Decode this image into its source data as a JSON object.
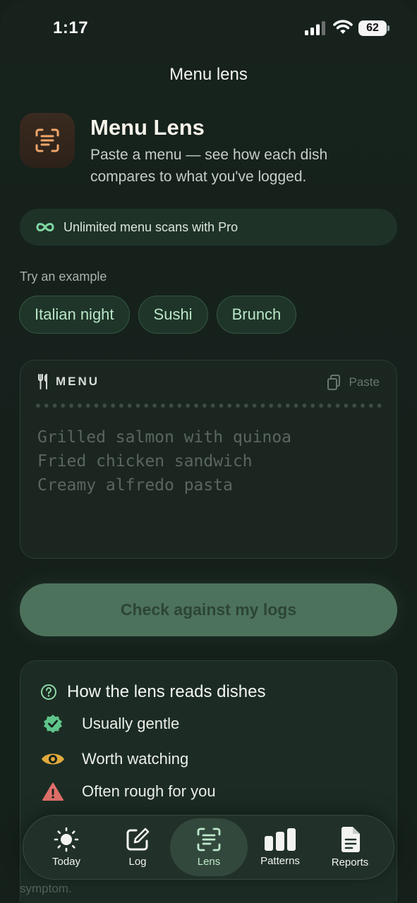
{
  "status_bar": {
    "time": "1:17",
    "battery": "62"
  },
  "nav": {
    "title": "Menu lens"
  },
  "header": {
    "icon": "document-scan-icon",
    "title": "Menu Lens",
    "subtitle": "Paste a menu — see how each dish compares to what you've logged."
  },
  "pro_banner": {
    "icon": "infinity-icon",
    "text": "Unlimited menu scans with Pro"
  },
  "examples": {
    "label": "Try an example",
    "chips": [
      "Italian night",
      "Sushi",
      "Brunch"
    ]
  },
  "menu_input": {
    "label": "MENU",
    "paste_label": "Paste",
    "placeholder_lines": [
      "Grilled salmon with quinoa",
      "Fried chicken sandwich",
      "Creamy alfredo pasta"
    ]
  },
  "primary_action": {
    "label": "Check against my logs"
  },
  "how_it_reads": {
    "title": "How the lens reads dishes",
    "items": [
      {
        "icon": "check-badge-icon",
        "label": "Usually gentle",
        "color": "#5fc48a"
      },
      {
        "icon": "eye-icon",
        "label": "Worth watching",
        "color": "#e0a93b"
      },
      {
        "icon": "warning-triangle-icon",
        "label": "Often rough for you",
        "color": "#e0706a"
      }
    ],
    "partial_text": "symptom."
  },
  "tab_bar": {
    "active": "Lens",
    "tabs": [
      {
        "label": "Today",
        "icon": "sun-icon"
      },
      {
        "label": "Log",
        "icon": "edit-square-icon"
      },
      {
        "label": "Lens",
        "icon": "document-scan-icon"
      },
      {
        "label": "Patterns",
        "icon": "bar-chart-icon"
      },
      {
        "label": "Reports",
        "icon": "document-icon"
      }
    ]
  },
  "colors": {
    "background": "#15201b",
    "accent": "#b9e6c7",
    "button": "#4d725c",
    "brand_icon": "#f0a66a"
  }
}
